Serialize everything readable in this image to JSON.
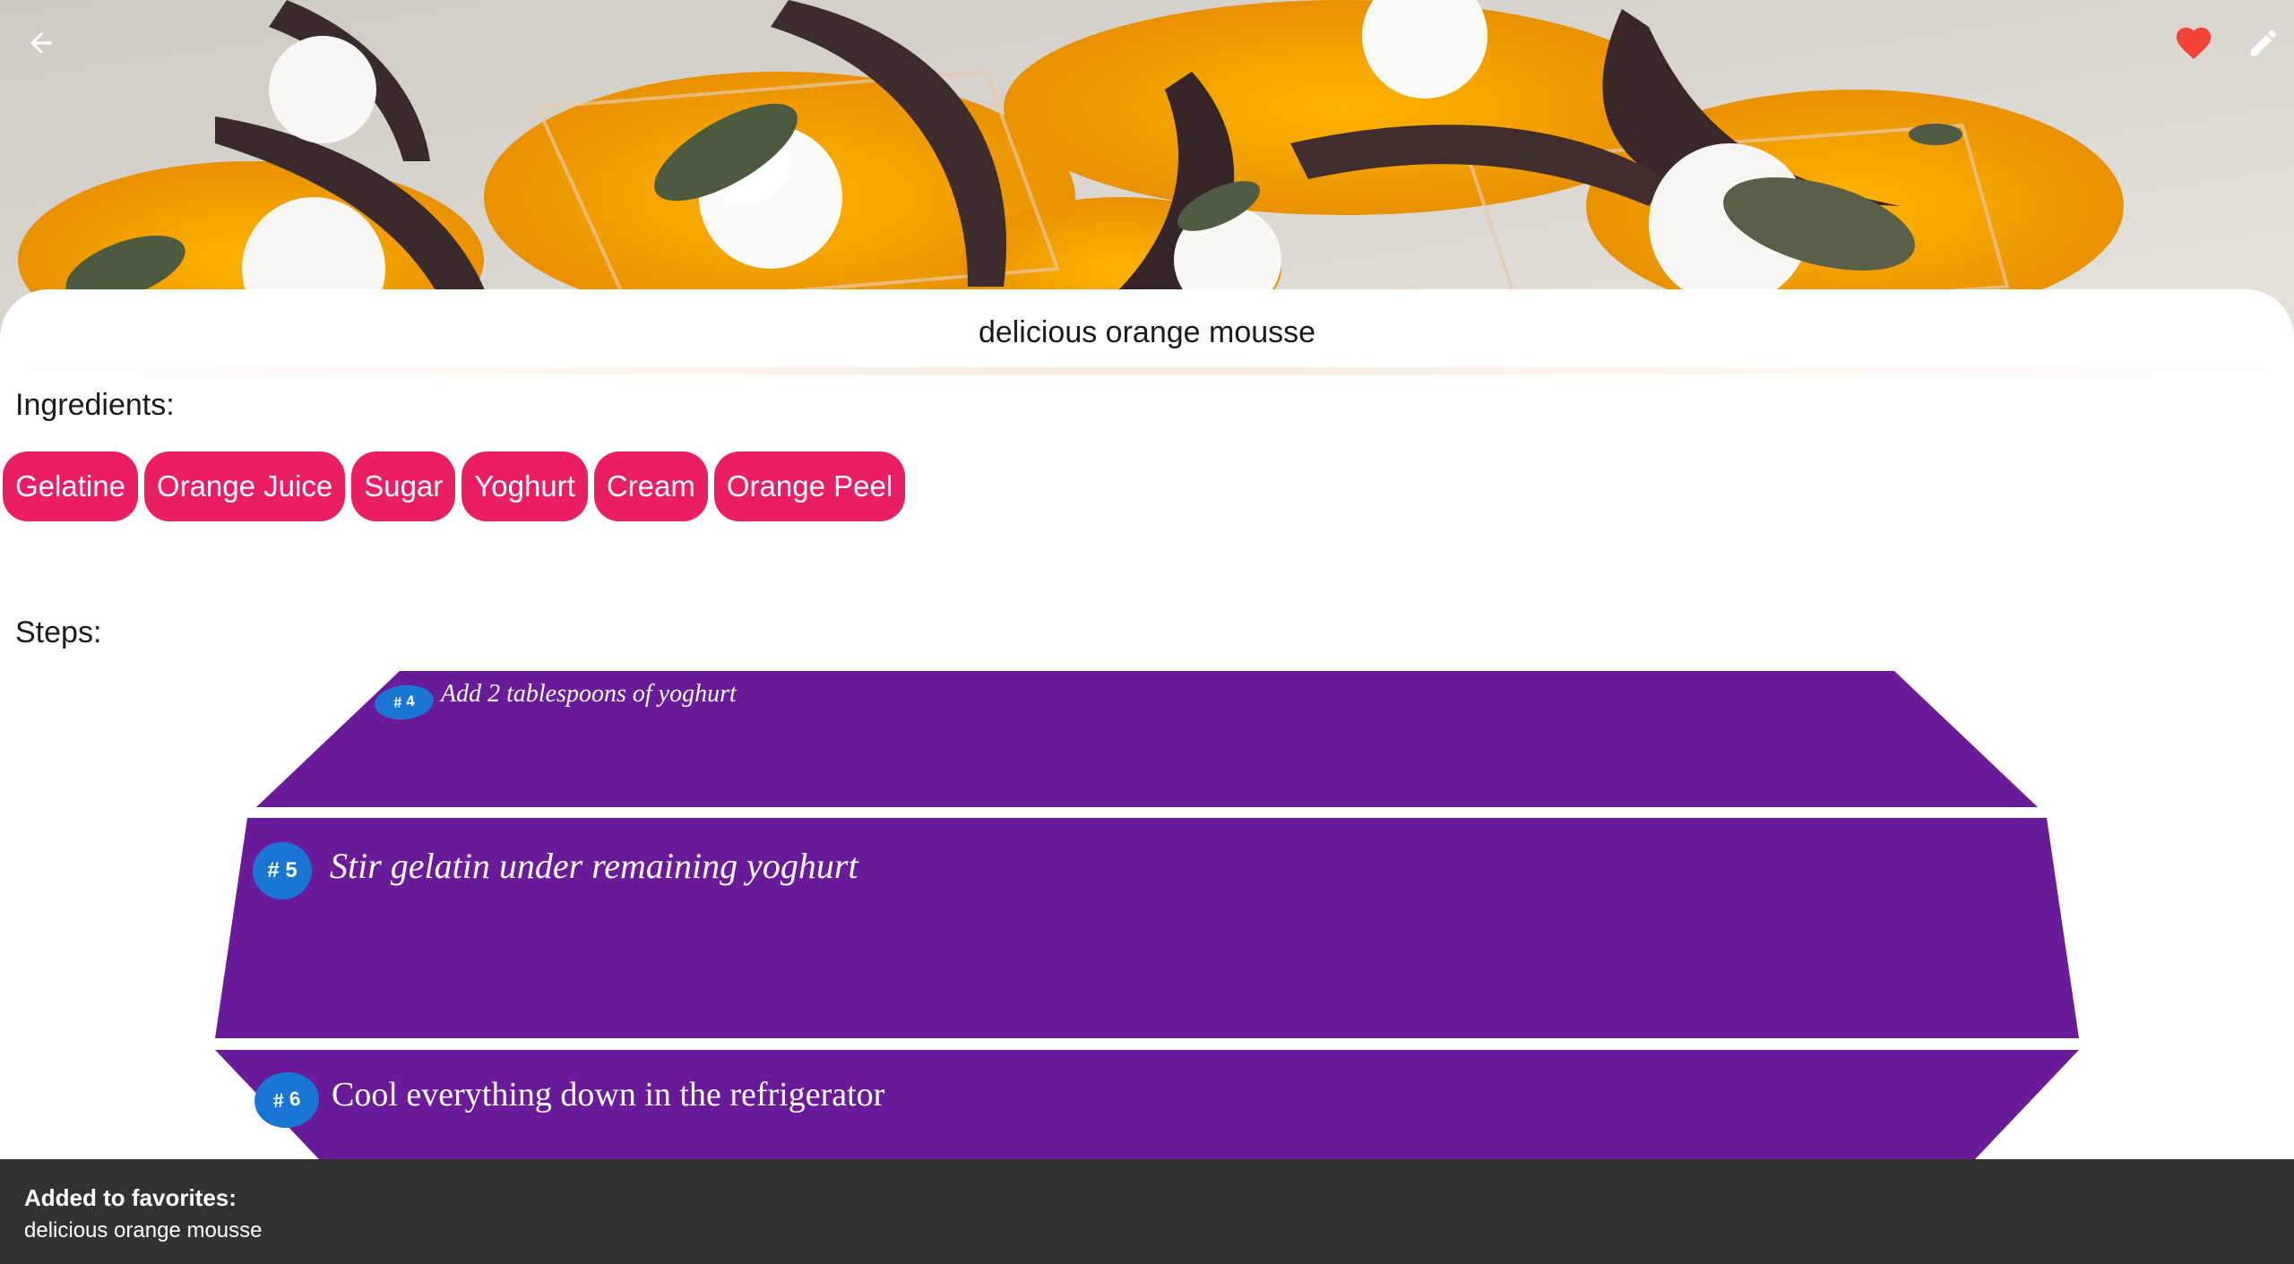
{
  "header": {
    "back_icon": "arrow-back-icon",
    "favorite_icon": "heart-icon",
    "edit_icon": "pencil-icon",
    "favorite_color": "#f44336"
  },
  "recipe": {
    "title": "delicious orange mousse"
  },
  "ingredients": {
    "label": "Ingredients:",
    "items": [
      {
        "label": "Gelatine"
      },
      {
        "label": "Orange Juice"
      },
      {
        "label": "Sugar"
      },
      {
        "label": "Yoghurt"
      },
      {
        "label": "Cream"
      },
      {
        "label": "Orange Peel"
      }
    ],
    "chip_color": "#e91e63"
  },
  "steps": {
    "label": "Steps:",
    "card_color": "#6a1b9a",
    "badge_color": "#1976d2",
    "items": [
      {
        "badge": "# 4",
        "text": "Add 2 tablespoons of yoghurt"
      },
      {
        "badge": "# 5",
        "text": "Stir gelatin under remaining yoghurt"
      },
      {
        "badge": "# 6",
        "text": "Cool everything down in the refrigerator"
      }
    ]
  },
  "snackbar": {
    "title": "Added to favorites:",
    "message": "delicious orange mousse"
  }
}
